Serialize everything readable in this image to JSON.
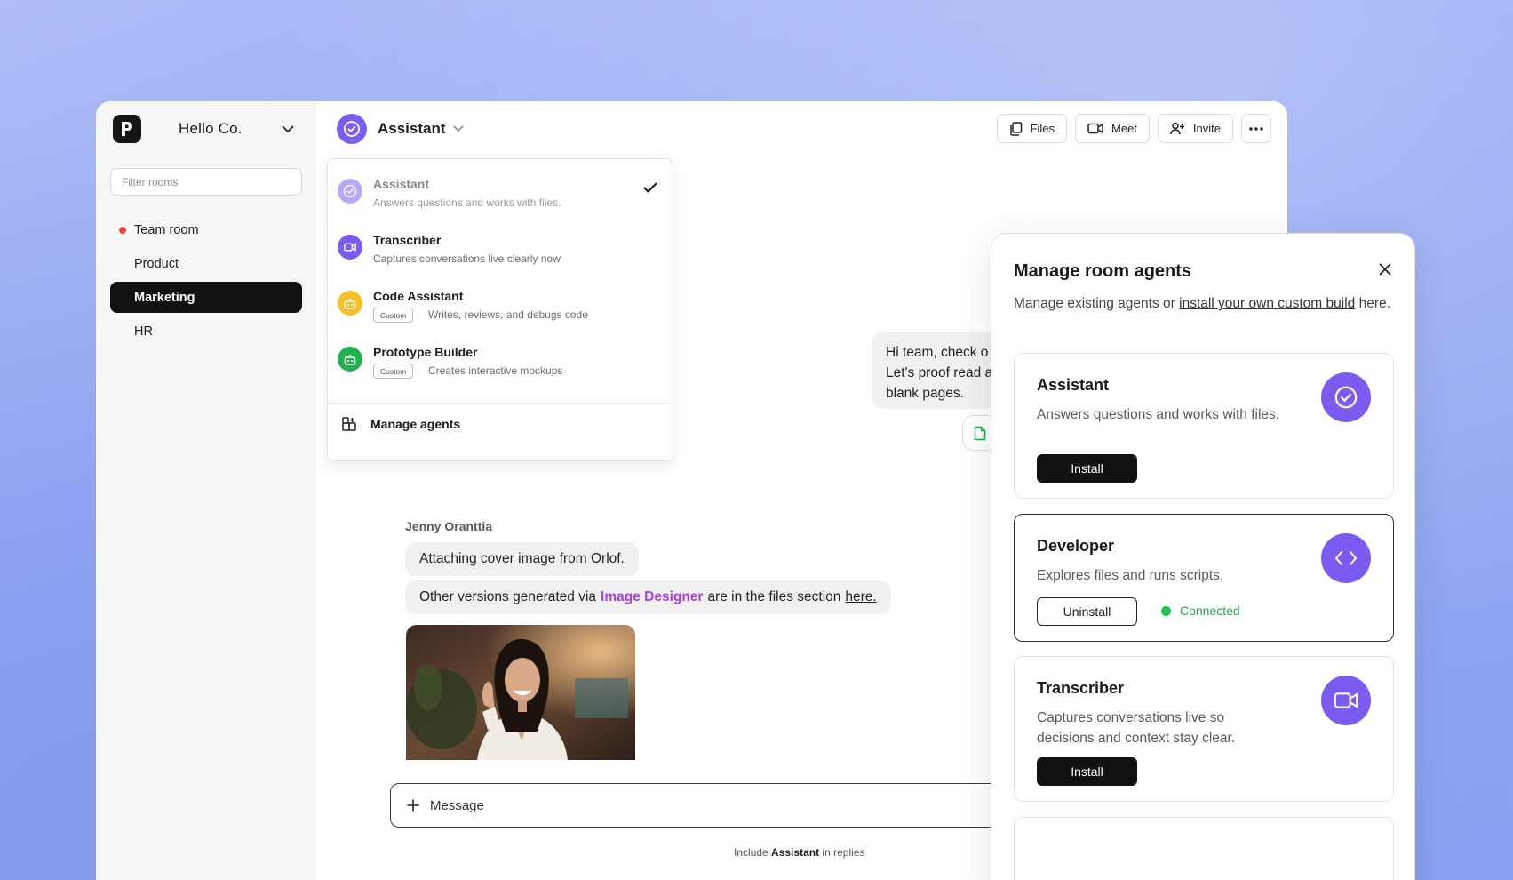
{
  "workspace": {
    "name": "Hello Co."
  },
  "sidebar": {
    "filter_placeholder": "Filter rooms",
    "rooms": [
      {
        "label": "Team room",
        "unread": true
      },
      {
        "label": "Product"
      },
      {
        "label": "Marketing",
        "active": true
      },
      {
        "label": "HR"
      }
    ]
  },
  "header": {
    "agent_name": "Assistant",
    "actions": {
      "files": "Files",
      "meet": "Meet",
      "invite": "Invite"
    }
  },
  "agent_menu": {
    "items": [
      {
        "name": "Assistant",
        "desc": "Answers questions and works with files.",
        "selected": true,
        "color": "#b9a8f7"
      },
      {
        "name": "Transcriber",
        "desc": "Captures conversations live clearly now",
        "color": "#7c5cf0"
      },
      {
        "name": "Code Assistant",
        "badge": "Custom",
        "desc": "Writes, reviews, and debugs code",
        "color": "#f5c02a"
      },
      {
        "name": "Prototype Builder",
        "badge": "Custom",
        "desc": "Creates interactive mockups",
        "color": "#23b04f"
      }
    ],
    "manage_label": "Manage agents"
  },
  "chat": {
    "right_message_lines": [
      "Hi team, check o",
      "Let's proof read a",
      "blank pages."
    ],
    "sender": "Jenny Oranttia",
    "msg1": "Attaching cover image from Orlof.",
    "msg2_before": "Other versions generated via",
    "msg2_link": "Image Designer",
    "msg2_after": "are in the files section",
    "msg2_here": "here.",
    "composer_placeholder": "Message",
    "hint_before": "Include",
    "hint_agent": "Assistant",
    "hint_after": "in replies"
  },
  "panel": {
    "title": "Manage room agents",
    "subtitle_before": "Manage existing agents or",
    "subtitle_link": "install your own custom build",
    "subtitle_after": "here.",
    "cards": [
      {
        "name": "Assistant",
        "desc": "Answers questions and works with files.",
        "action": "Install",
        "icon": "check-circle-icon"
      },
      {
        "name": "Developer",
        "desc": "Explores files and runs scripts.",
        "action": "Uninstall",
        "status": "Connected",
        "icon": "code-icon"
      },
      {
        "name": "Transcriber",
        "desc": "Captures conversations live so decisions and context stay clear.",
        "action": "Install",
        "icon": "video-icon"
      }
    ]
  },
  "colors": {
    "accent": "#7c5cf0",
    "connected": "#22a54a",
    "link_purple": "#a93fe6"
  }
}
